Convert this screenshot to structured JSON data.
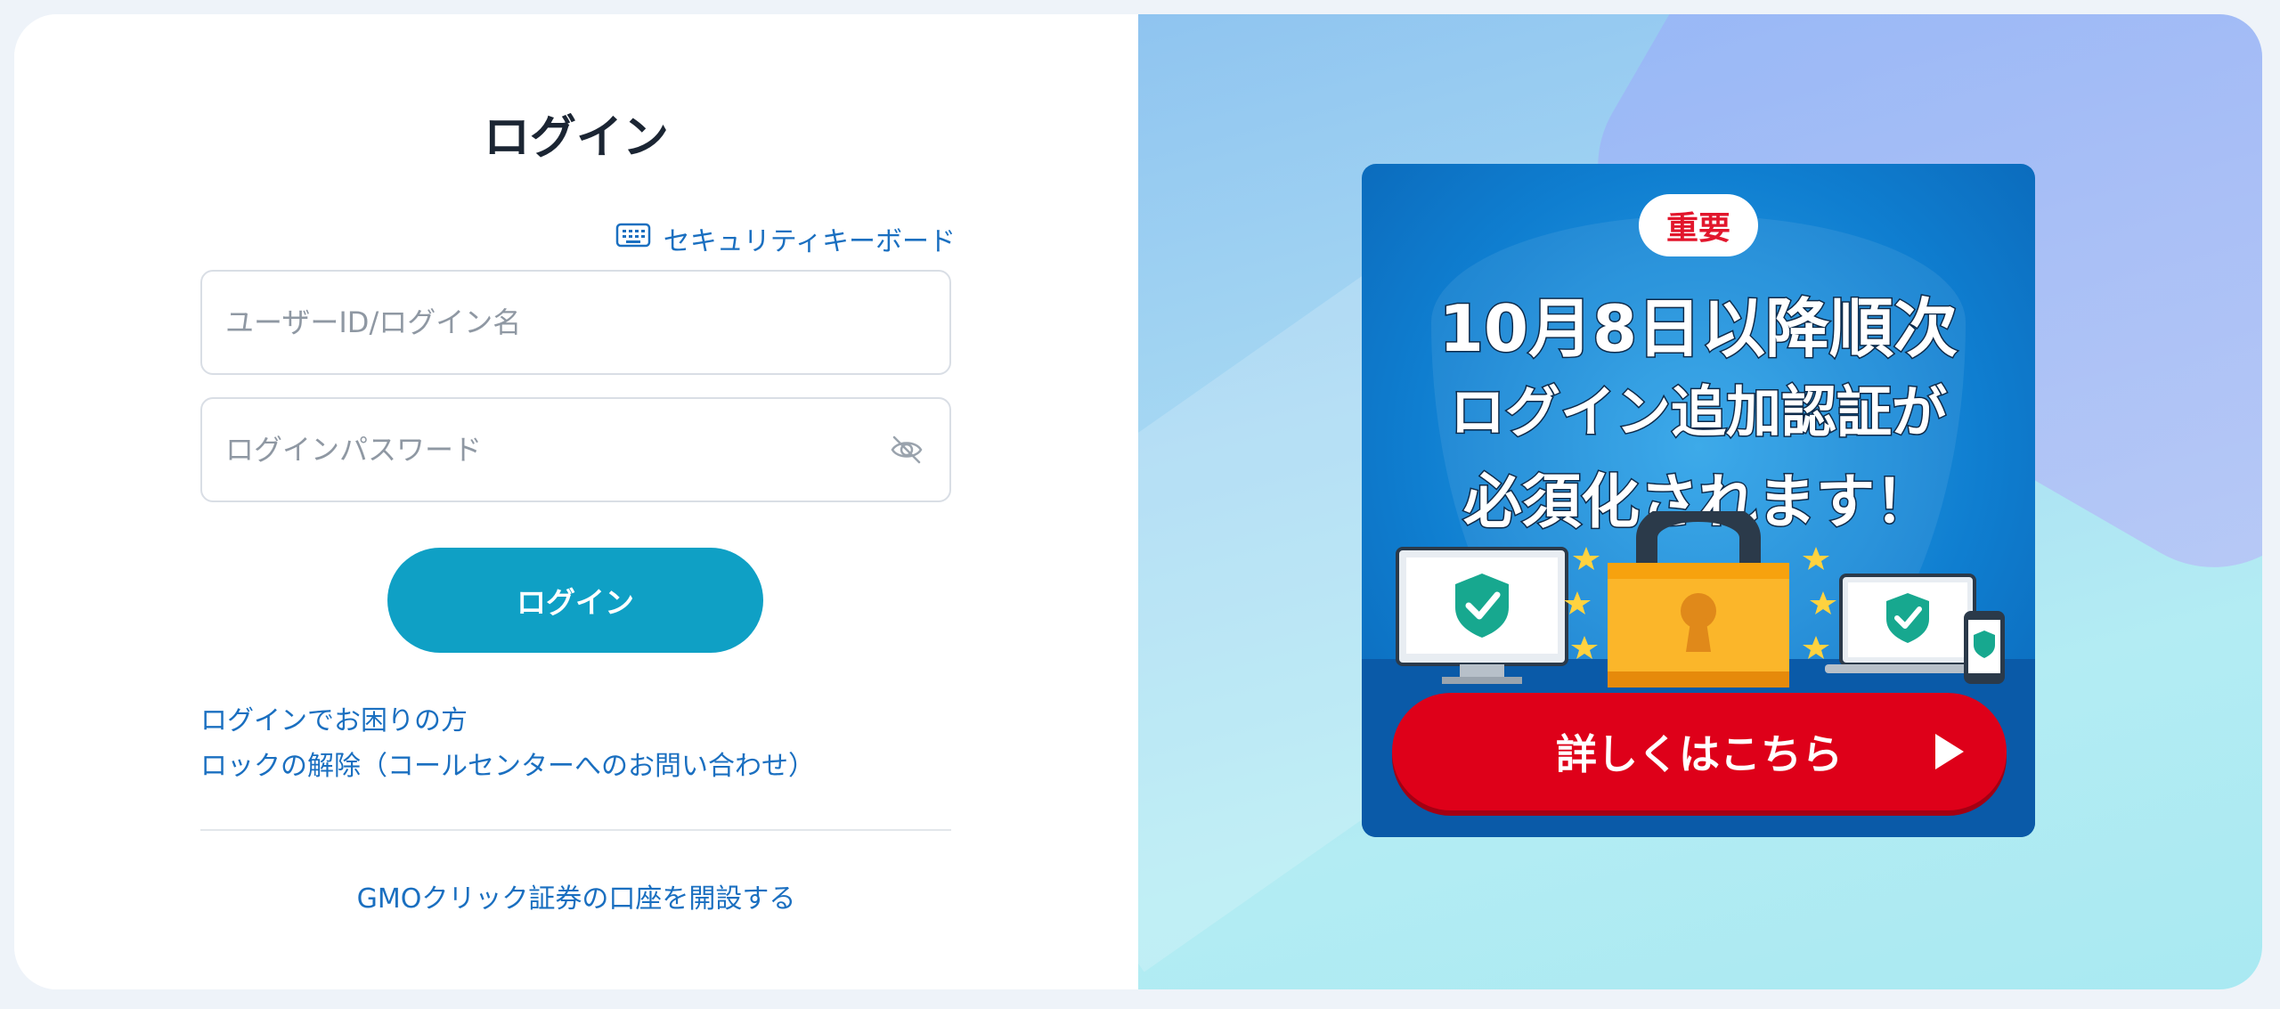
{
  "login": {
    "title": "ログイン",
    "security_keyboard_label": "セキュリティキーボード",
    "userid_placeholder": "ユーザーID/ログイン名",
    "password_placeholder": "ログインパスワード",
    "login_button": "ログイン",
    "help_link": "ログインでお困りの方",
    "unlock_link": "ロックの解除（コールセンターへのお問い合わせ）",
    "open_account_link": "GMOクリック証券の口座を開設する"
  },
  "banner": {
    "badge": "重要",
    "headline_line1": "10月8日以降順次",
    "headline_line2": "ログイン追加認証が",
    "headline_line3": "必須化されます！",
    "cta": "詳しくはこちら"
  },
  "colors": {
    "accent": "#0fa0c5",
    "link": "#1a6fc0",
    "cta": "#de0019",
    "badge_text": "#e2162c"
  },
  "icons": {
    "keyboard": "keyboard-icon",
    "eye_off": "eye-off-icon",
    "cta_arrow": "play-arrow-icon"
  }
}
